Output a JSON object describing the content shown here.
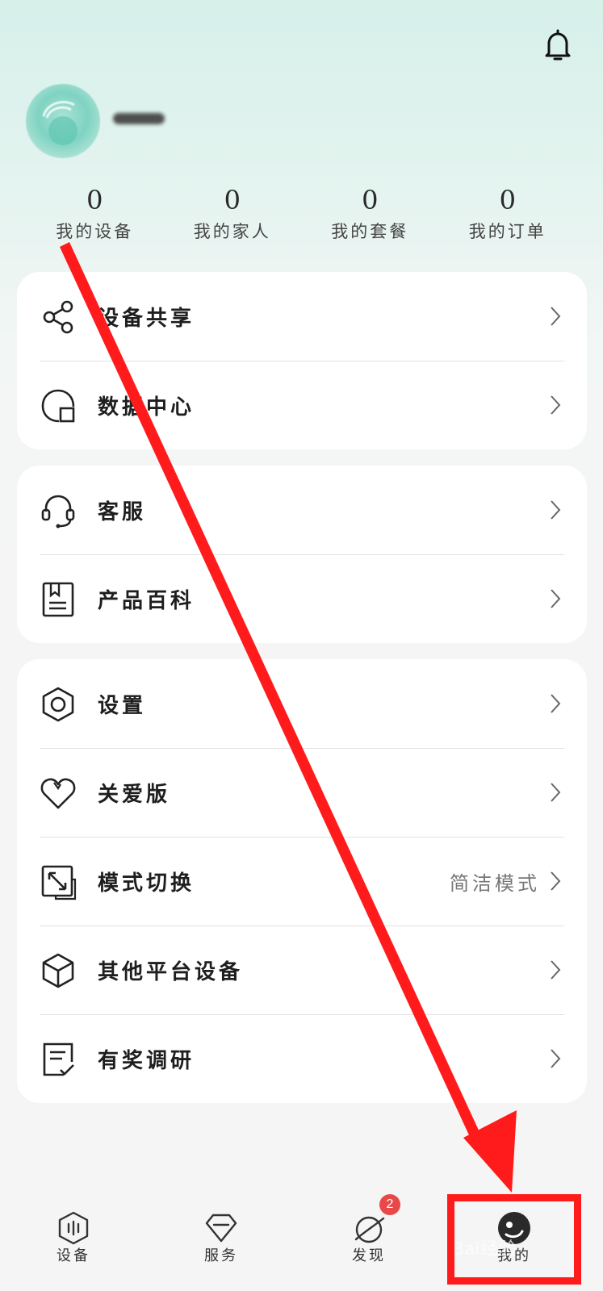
{
  "header": {
    "username": "",
    "stats": [
      {
        "value": "0",
        "label": "我的设备"
      },
      {
        "value": "0",
        "label": "我的家人"
      },
      {
        "value": "0",
        "label": "我的套餐"
      },
      {
        "value": "0",
        "label": "我的订单"
      }
    ]
  },
  "menu": {
    "group1": [
      {
        "label": "设备共享",
        "icon": "share-icon"
      },
      {
        "label": "数据中心",
        "icon": "data-center-icon"
      }
    ],
    "group2": [
      {
        "label": "客服",
        "icon": "headset-icon"
      },
      {
        "label": "产品百科",
        "icon": "book-icon"
      }
    ],
    "group3": [
      {
        "label": "设置",
        "icon": "settings-hexagon-icon"
      },
      {
        "label": "关爱版",
        "icon": "heart-icon"
      },
      {
        "label": "模式切换",
        "value": "简洁模式",
        "icon": "resize-icon"
      },
      {
        "label": "其他平台设备",
        "icon": "cube-icon"
      },
      {
        "label": "有奖调研",
        "icon": "survey-icon"
      }
    ]
  },
  "tabs": [
    {
      "label": "设备",
      "icon": "device-tab-icon"
    },
    {
      "label": "服务",
      "icon": "service-tab-icon"
    },
    {
      "label": "发现",
      "icon": "discover-tab-icon",
      "badge": "2"
    },
    {
      "label": "我的",
      "icon": "mine-tab-icon",
      "active": true
    }
  ],
  "watermark": "Bai经验",
  "annotation": {
    "color": "#ff1b1b"
  }
}
